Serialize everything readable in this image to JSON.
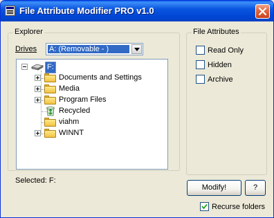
{
  "window": {
    "title": "File Attribute Modifier PRO v1.0"
  },
  "explorer": {
    "group_label": "Explorer",
    "drives_label": "Drives",
    "drive_selected": "A: (Removable - )",
    "tree": {
      "root": "F:",
      "items": [
        {
          "label": "Documents and Settings",
          "icon": "folder-icon",
          "expandable": true
        },
        {
          "label": "Media",
          "icon": "folder-icon",
          "expandable": true
        },
        {
          "label": "Program Files",
          "icon": "folder-icon",
          "expandable": true
        },
        {
          "label": "Recycled",
          "icon": "recycle-bin-icon",
          "expandable": false
        },
        {
          "label": "viahm",
          "icon": "folder-icon",
          "expandable": false
        },
        {
          "label": "WINNT",
          "icon": "folder-icon",
          "expandable": true
        }
      ]
    },
    "selected_text": "Selected: F:"
  },
  "attributes": {
    "group_label": "File Attributes",
    "read_only": "Read Only",
    "hidden": "Hidden",
    "archive": "Archive"
  },
  "actions": {
    "modify_label": "Modify!",
    "help_label": "?",
    "recurse_label": "Recurse folders",
    "recurse_checked": true
  },
  "colors": {
    "titlebar": "#0054e3",
    "selection": "#316ac5",
    "face": "#ece9d8"
  }
}
